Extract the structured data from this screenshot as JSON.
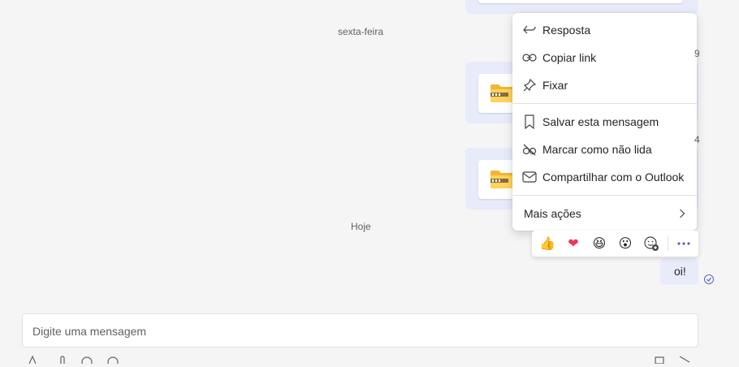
{
  "chat": {
    "date_friday": "sexta-feira",
    "date_today": "Hoje",
    "last_message": "oi!"
  },
  "context_menu": {
    "items": [
      {
        "label": "Resposta",
        "icon": "reply-icon"
      },
      {
        "label": "Copiar link",
        "icon": "link-icon"
      },
      {
        "label": "Fixar",
        "icon": "pin-icon"
      },
      {
        "label": "Salvar esta mensagem",
        "icon": "bookmark-icon"
      },
      {
        "label": "Marcar como não lida",
        "icon": "eye-off-icon"
      },
      {
        "label": "Compartilhar com o Outlook",
        "icon": "mail-icon"
      }
    ],
    "more_actions": "Mais ações"
  },
  "reactions": [
    {
      "icon": "thumbs-up-icon",
      "glyph": "👍"
    },
    {
      "icon": "heart-icon",
      "glyph": "❤"
    },
    {
      "icon": "laugh-icon",
      "glyph": "😆"
    },
    {
      "icon": "surprised-icon",
      "glyph": "😮"
    }
  ],
  "compose": {
    "placeholder": "Digite uma mensagem"
  },
  "colors": {
    "accent": "#5b5fc7",
    "bubble": "#e8ebfa",
    "background": "#f5f5f5"
  }
}
